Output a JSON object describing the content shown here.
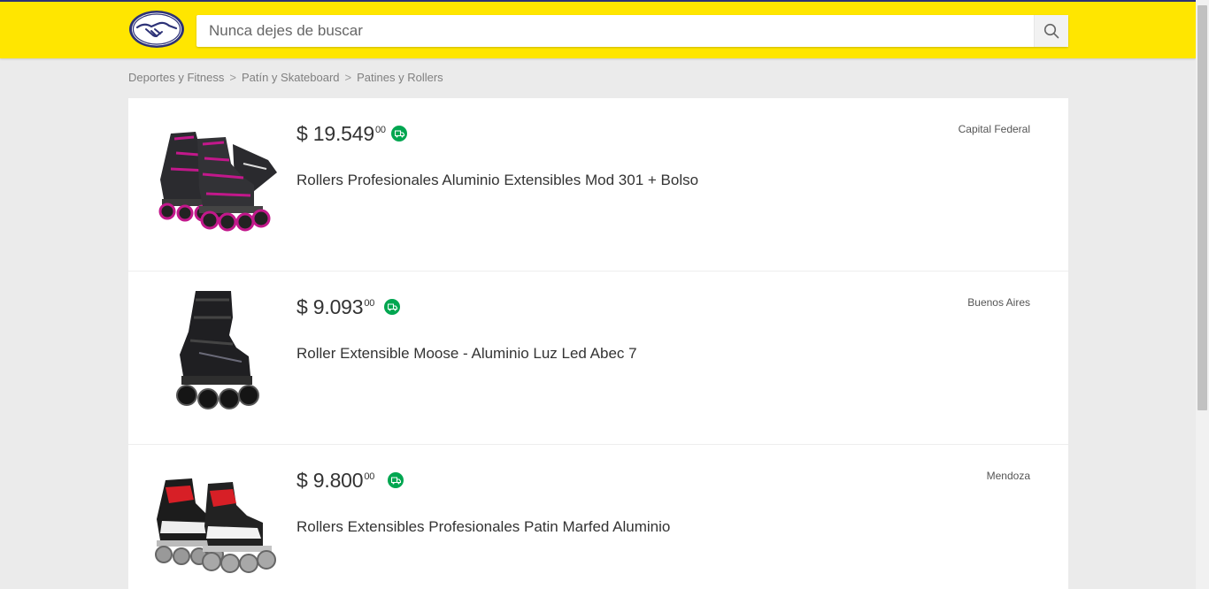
{
  "header": {
    "search": {
      "placeholder": "Nunca dejes de buscar",
      "value": ""
    },
    "colors": {
      "brand_yellow": "#ffe600",
      "brand_blue": "#2d3277"
    }
  },
  "breadcrumb": [
    "Deportes y Fitness",
    "Patín y Skateboard",
    "Patines y Rollers"
  ],
  "breadcrumb_separator": ">",
  "results": [
    {
      "price_currency": "$",
      "price_whole": "19.549",
      "price_cents": "00",
      "title": "Rollers Profesionales Aluminio Extensibles Mod 301 + Bolso",
      "location": "Capital Federal",
      "image": "pink-inline-skates-with-bag",
      "shipping_icon": "truck-icon"
    },
    {
      "price_currency": "$",
      "price_whole": "9.093",
      "price_cents": "00",
      "title": "Roller Extensible Moose - Aluminio Luz Led Abec 7",
      "location": "Buenos Aires",
      "image": "black-inline-skate",
      "shipping_icon": "truck-icon"
    },
    {
      "price_currency": "$",
      "price_whole": "9.800",
      "price_cents": "00",
      "title": "Rollers Extensibles Profesionales Patin Marfed Aluminio",
      "location": "Mendoza",
      "image": "red-inline-skates",
      "shipping_icon": "truck-icon"
    }
  ]
}
